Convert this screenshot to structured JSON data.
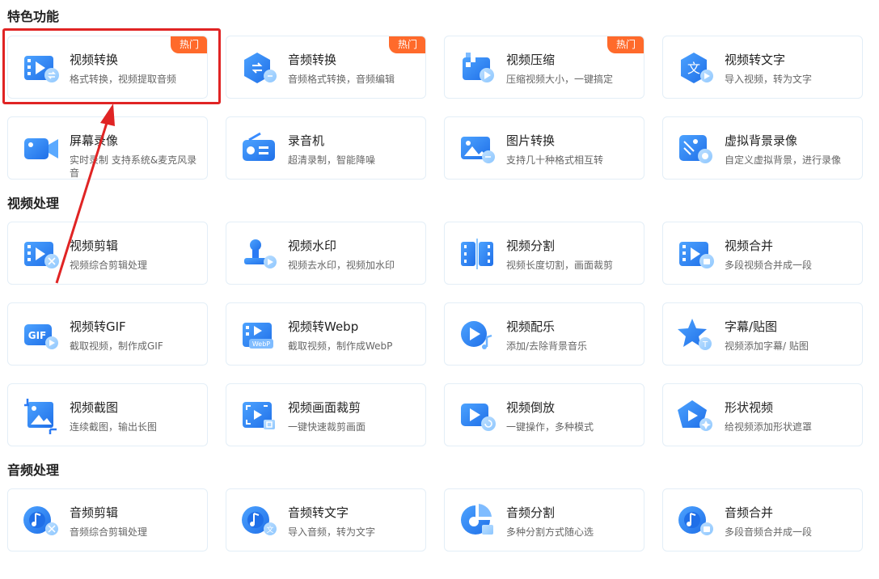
{
  "sections": {
    "featured": "特色功能",
    "video": "视频处理",
    "audio": "音频处理"
  },
  "hot_label": "热门",
  "colors": {
    "accent": "#2b7bf5",
    "hot": "#ff6a2b",
    "highlight": "#e02424"
  },
  "cards": {
    "video_convert": {
      "title": "视频转换",
      "desc": "格式转换，视频提取音频",
      "icon": "video-convert-icon"
    },
    "audio_convert": {
      "title": "音频转换",
      "desc": "音频格式转换，音频编辑",
      "icon": "audio-convert-icon"
    },
    "video_compress": {
      "title": "视频压缩",
      "desc": "压缩视频大小，一键搞定",
      "icon": "video-compress-icon"
    },
    "video_to_text": {
      "title": "视频转文字",
      "desc": "导入视频，转为文字",
      "icon": "video-to-text-icon"
    },
    "screen_record": {
      "title": "屏幕录像",
      "desc": "实时录制 支持系统&麦克风录音",
      "icon": "screen-record-icon"
    },
    "recorder": {
      "title": "录音机",
      "desc": "超清录制，智能降噪",
      "icon": "recorder-icon"
    },
    "image_convert": {
      "title": "图片转换",
      "desc": "支持几十种格式相互转",
      "icon": "image-convert-icon"
    },
    "virtual_bg": {
      "title": "虚拟背景录像",
      "desc": "自定义虚拟背景，进行录像",
      "icon": "virtual-background-icon"
    },
    "video_edit": {
      "title": "视频剪辑",
      "desc": "视频综合剪辑处理",
      "icon": "video-edit-icon"
    },
    "watermark": {
      "title": "视频水印",
      "desc": "视频去水印，视频加水印",
      "icon": "watermark-icon"
    },
    "video_split": {
      "title": "视频分割",
      "desc": "视频长度切割，画面裁剪",
      "icon": "video-split-icon"
    },
    "video_merge": {
      "title": "视频合并",
      "desc": "多段视频合并成一段",
      "icon": "video-merge-icon"
    },
    "to_gif": {
      "title": "视频转GIF",
      "desc": "截取视频，制作成GIF",
      "icon": "gif-icon"
    },
    "to_webp": {
      "title": "视频转Webp",
      "desc": "截取视频，制作成WebP",
      "icon": "webp-icon"
    },
    "music": {
      "title": "视频配乐",
      "desc": "添加/去除背景音乐",
      "icon": "music-icon"
    },
    "subtitle": {
      "title": "字幕/贴图",
      "desc": "视频添加字幕/ 贴图",
      "icon": "subtitle-sticker-icon"
    },
    "screenshot": {
      "title": "视频截图",
      "desc": "连续截图，输出长图",
      "icon": "screenshot-icon"
    },
    "crop": {
      "title": "视频画面裁剪",
      "desc": "一键快速裁剪画面",
      "icon": "crop-icon"
    },
    "reverse": {
      "title": "视频倒放",
      "desc": "一键操作，多种模式",
      "icon": "reverse-icon"
    },
    "shape": {
      "title": "形状视频",
      "desc": "给视频添加形状遮罩",
      "icon": "shape-video-icon"
    },
    "audio_edit": {
      "title": "音频剪辑",
      "desc": "音频综合剪辑处理",
      "icon": "audio-edit-icon"
    },
    "audio_to_text": {
      "title": "音频转文字",
      "desc": "导入音频，转为文字",
      "icon": "audio-to-text-icon"
    },
    "audio_split": {
      "title": "音频分割",
      "desc": "多种分割方式随心选",
      "icon": "audio-split-icon"
    },
    "audio_merge": {
      "title": "音频合并",
      "desc": "多段音频合并成一段",
      "icon": "audio-merge-icon"
    }
  },
  "icon_labels": {
    "gif": "GIF",
    "webp": "WebP"
  }
}
